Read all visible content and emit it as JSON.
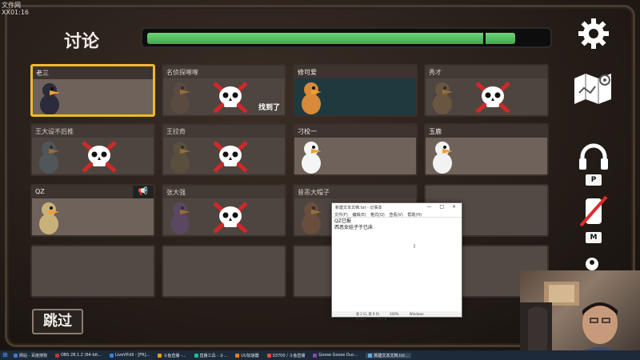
{
  "corner_tag": {
    "line1": "文件网",
    "line2": "XX01:16"
  },
  "header": {
    "title": "讨论"
  },
  "timer": {
    "progress": 0.92
  },
  "players": [
    {
      "name": "老三",
      "status": "alive",
      "selected": true
    },
    {
      "name": "名侦探啄啄",
      "status": "dead",
      "found_label": "找到了"
    },
    {
      "name": "修可爱",
      "status": "alive",
      "theme": "teal"
    },
    {
      "name": "秀才",
      "status": "dead"
    },
    {
      "name": "王大设不后推",
      "status": "dead"
    },
    {
      "name": "王拉奇",
      "status": "dead"
    },
    {
      "name": "刁校一",
      "status": "alive"
    },
    {
      "name": "玉鹿",
      "status": "alive"
    },
    {
      "name": "QZ",
      "status": "alive",
      "speaking": true
    },
    {
      "name": "张大强",
      "status": "dead"
    },
    {
      "name": "昔恶大帽子",
      "status": "dead"
    },
    {
      "name": "",
      "status": "empty"
    },
    {
      "name": "",
      "status": "empty"
    },
    {
      "name": "",
      "status": "empty"
    },
    {
      "name": "",
      "status": "empty"
    },
    {
      "name": "",
      "status": "empty"
    }
  ],
  "skip_button": {
    "label": "跳过"
  },
  "side": {
    "settings_icon": "gear-icon",
    "map_icon": "map-icon",
    "headphones_key": "P",
    "mic_key": "M"
  },
  "notepad": {
    "title": "新建文本文档.txt - 记事本",
    "menu": [
      "文件(F)",
      "编辑(E)",
      "格式(O)",
      "查看(V)",
      "帮助(H)"
    ],
    "lines": [
      "QZ已报",
      "西恶女娃子于已床"
    ],
    "status": [
      "第 2 行, 第 9 列",
      "100%",
      "Windows (CRLF)",
      "UTF-8"
    ],
    "controls": "— □ ×"
  },
  "taskbar": {
    "items": [
      {
        "label": "网站 - 百度搜狗",
        "color": "#3a7bd5"
      },
      {
        "label": "OBS 28.1.2 (64-bit...",
        "color": "#c0392b"
      },
      {
        "label": "LiveVP.dll - [FR]...",
        "color": "#2e86de"
      },
      {
        "label": "斗鱼直播 -...",
        "color": "#f39c12"
      },
      {
        "label": "直播工具 - 斗...",
        "color": "#1abc9c"
      },
      {
        "label": "UU加速器",
        "color": "#e67e22"
      },
      {
        "label": "03700 / 斗鱼直播",
        "color": "#e74c3c"
      },
      {
        "label": "Goose Goose Duc...",
        "color": "#8e44ad"
      },
      {
        "label": "新建文本文档.txt...",
        "color": "#5dade2",
        "active": true
      }
    ]
  }
}
